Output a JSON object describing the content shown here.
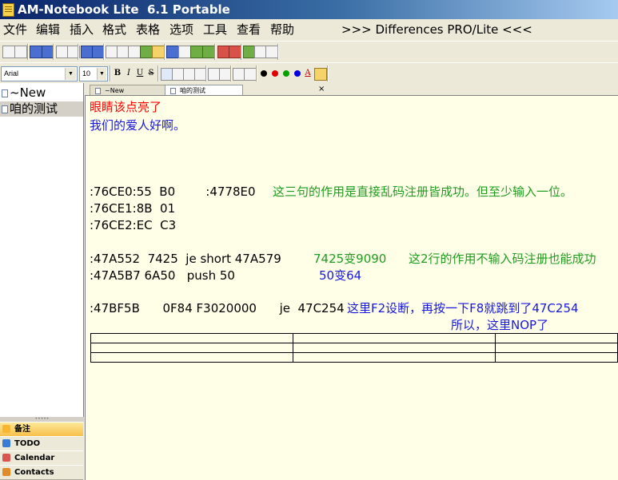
{
  "window": {
    "title": "AM-Notebook Lite  6.1 Portable"
  },
  "menu": {
    "items": [
      "文件",
      "编辑",
      "插入",
      "格式",
      "表格",
      "选项",
      "工具",
      "查看",
      "帮助"
    ],
    "differences_link": ">>> Differences PRO/Lite <<<"
  },
  "format_bar": {
    "font": "Arial",
    "size": "10",
    "bold": "B",
    "italic": "I",
    "underline": "U",
    "strike": "S",
    "colors": [
      "#000000",
      "#e00000",
      "#00a000",
      "#0000e0"
    ],
    "font_color_icon": "A"
  },
  "tree": {
    "items": [
      "~New",
      "咱的测试"
    ],
    "selected_index": 1
  },
  "tabs": [
    {
      "label": "~New"
    },
    {
      "label": "咱的测试"
    }
  ],
  "bottom_nav": [
    {
      "label": "备注",
      "icon": "note-icon",
      "color": "#f7b733"
    },
    {
      "label": "TODO",
      "icon": "todo-icon",
      "color": "#3a7bd5"
    },
    {
      "label": "Calendar",
      "icon": "calendar-icon",
      "color": "#d9534f"
    },
    {
      "label": "Contacts",
      "icon": "contacts-icon",
      "color": "#e08a2a"
    }
  ],
  "editor": {
    "line1": "眼睛该点亮了",
    "line2": "我们的爱人好啊。",
    "line3_code": ":76CE0:55  B0        :4778E0",
    "line3_comment": "这三句的作用是直接乱码注册皆成功。但至少输入一位。",
    "line4": ":76CE1:8B  01",
    "line5": ":76CE2:EC  C3",
    "line6_code": ":47A552  7425  je short 47A579",
    "line6_val": "7425变9090",
    "line6_comment": "这2行的作用不输入码注册也能成功",
    "line7_code": ":47A5B7 6A50   push 50",
    "line7_val": "50变64",
    "line8_code": ":47BF5B      0F84 F3020000      je  47C254",
    "line8_comment": "这里F2设断，再按一下F8就跳到了47C254",
    "line9": "所以，这里NOP了"
  }
}
